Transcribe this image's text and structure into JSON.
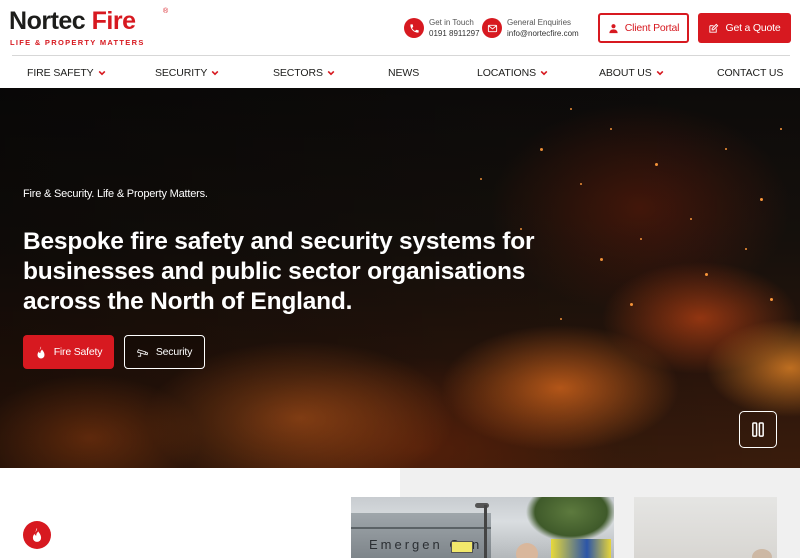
{
  "brand": {
    "logo_main_black": "N",
    "logo_main_rest": "ortec",
    "logo_fire": "Fire",
    "registered": "®",
    "tagline": "LIFE & PROPERTY MATTERS",
    "primary_color": "#d71920"
  },
  "header": {
    "phone": {
      "label": "Get in Touch",
      "value": "0191 8911297",
      "icon": "phone-icon"
    },
    "email": {
      "label": "General Enquiries",
      "value": "info@nortecfire.com",
      "icon": "mail-icon"
    },
    "client_portal_label": "Client Portal",
    "get_quote_label": "Get a Quote"
  },
  "nav": {
    "items": [
      {
        "label": "FIRE SAFETY",
        "dropdown": true
      },
      {
        "label": "SECURITY",
        "dropdown": true
      },
      {
        "label": "SECTORS",
        "dropdown": true
      },
      {
        "label": "NEWS",
        "dropdown": false
      },
      {
        "label": "LOCATIONS",
        "dropdown": true
      },
      {
        "label": "ABOUT US",
        "dropdown": true
      },
      {
        "label": "CONTACT US",
        "dropdown": false
      }
    ]
  },
  "hero": {
    "eyebrow": "Fire & Security. Life & Property Matters.",
    "title": "Bespoke fire safety and security systems for businesses and public sector organisations across the North of England.",
    "btn_fire": "Fire Safety",
    "btn_security": "Security"
  },
  "photo": {
    "sign_text": "Emergen    Cen"
  }
}
